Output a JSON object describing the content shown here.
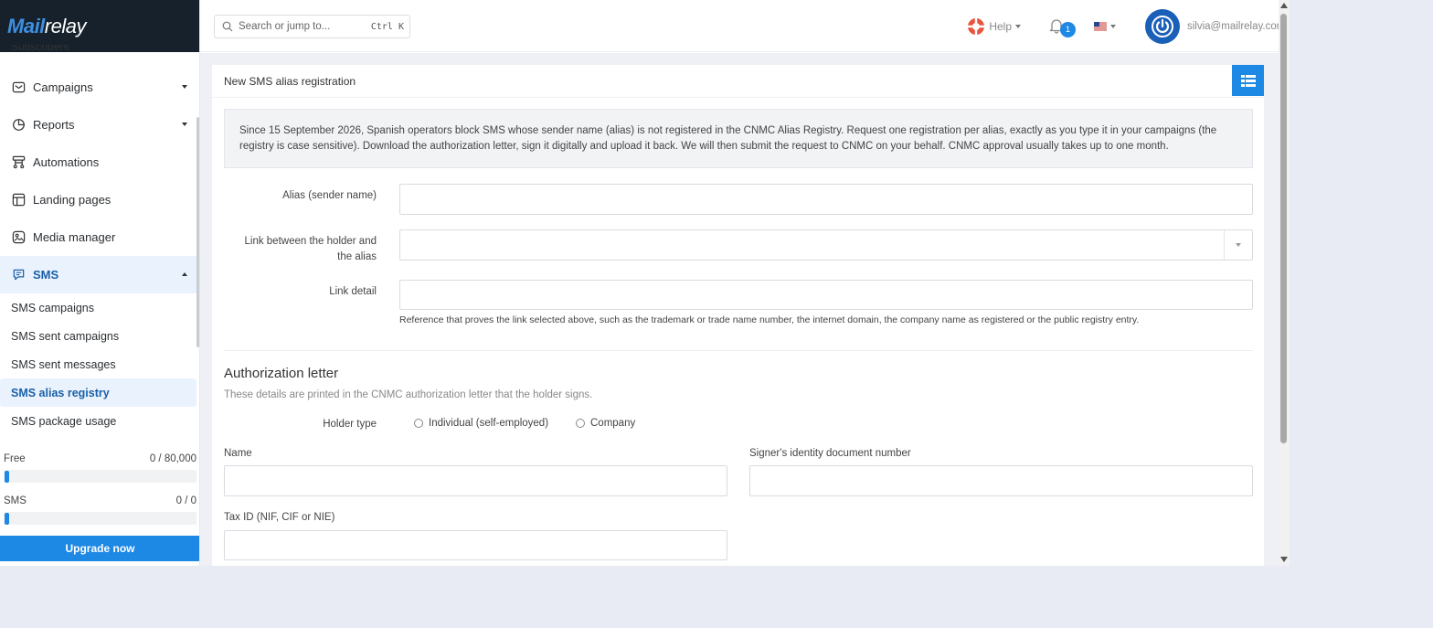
{
  "brand": {
    "logo_first": "M",
    "logo_mid": "ail",
    "logo_rest": "relay"
  },
  "sidebar": {
    "clipped_item": "Subscribers",
    "items": [
      {
        "label": "Campaigns",
        "icon": "envelope-icon",
        "has_caret": true
      },
      {
        "label": "Reports",
        "icon": "pie-chart-icon",
        "has_caret": true
      },
      {
        "label": "Automations",
        "icon": "flow-icon",
        "has_caret": false
      },
      {
        "label": "Landing pages",
        "icon": "layout-icon",
        "has_caret": false
      },
      {
        "label": "Media manager",
        "icon": "image-icon",
        "has_caret": false
      },
      {
        "label": "SMS",
        "icon": "chat-icon",
        "has_caret": true,
        "active": true
      }
    ],
    "sub_items": [
      {
        "label": "SMS campaigns"
      },
      {
        "label": "SMS sent campaigns"
      },
      {
        "label": "SMS sent messages"
      },
      {
        "label": "SMS alias registry",
        "selected": true
      },
      {
        "label": "SMS package usage"
      }
    ],
    "quotas": [
      {
        "label": "Free",
        "value": "0 / 80,000",
        "fill_fraction": 0.0
      },
      {
        "label": "SMS",
        "value": "0 / 0",
        "fill_fraction": 0.0
      }
    ],
    "upgrade_label": "Upgrade now"
  },
  "topbar": {
    "search_placeholder": "Search or jump to...",
    "search_shortcut": "Ctrl K",
    "help_label": "Help",
    "notifications_count": "1",
    "language": "en-US",
    "user_email": "silvia@mailrelay.com"
  },
  "page": {
    "title": "New SMS alias registration",
    "notice": "Since 15 September 2026, Spanish operators block SMS whose sender name (alias) is not registered in the CNMC Alias Registry. Request one registration per alias, exactly as you type it in your campaigns (the registry is case sensitive). Download the authorization letter, sign it digitally and upload it back. We will then submit the request to CNMC on your behalf. CNMC approval usually takes up to one month.",
    "alias_label": "Alias (sender name)",
    "alias_value": "",
    "link_label_1": "Link between the holder and",
    "link_label_2": "the alias",
    "link_value": "",
    "link_detail_label": "Link detail",
    "link_detail_value": "",
    "link_detail_hint": "Reference that proves the link selected above, such as the trademark or trade name number, the internet domain, the company name as registered or the public registry entry.",
    "auth_title": "Authorization letter",
    "auth_subtitle": "These details are printed in the CNMC authorization letter that the holder signs.",
    "holder_type_label": "Holder type",
    "holder_options": [
      "Individual (self-employed)",
      "Company"
    ],
    "name_label": "Name",
    "name_value": "",
    "signer_id_label": "Signer's identity document number",
    "signer_id_value": "",
    "tax_id_label": "Tax ID (NIF, CIF or NIE)",
    "tax_id_value": ""
  },
  "colors": {
    "accent": "#1e88e5",
    "brand_bg": "#16212b",
    "active_bg": "#eaf3fd"
  }
}
